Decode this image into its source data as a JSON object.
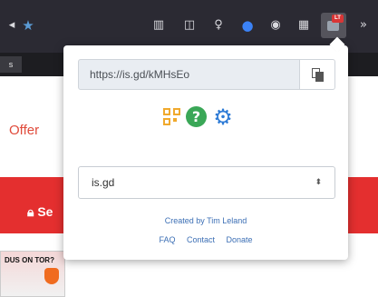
{
  "browser": {
    "toolbar_icons": [
      "library-icon",
      "sidebar-icon",
      "lightbulb-icon",
      "blue-extension-icon",
      "account-icon",
      "grid-icon",
      "active-extension-icon",
      "overflow-icon"
    ],
    "extension_badge": "LT"
  },
  "page": {
    "offer_text": "Offer",
    "red_band_label": "Se",
    "tab_label": "s",
    "ad_text": "DUS ON TOR?"
  },
  "popup": {
    "short_url": "https://is.gd/kMHsEo",
    "icons": [
      "qr-code-icon",
      "help-icon",
      "gear-icon"
    ],
    "help_glyph": "?",
    "service_select": {
      "selected": "is.gd"
    },
    "credit": "Created by Tim Leland",
    "links": [
      "FAQ",
      "Contact",
      "Donate"
    ]
  },
  "colors": {
    "toolbar_bg": "#2b2a33",
    "accent_red": "#e42f2f",
    "link_blue": "#3c6fb5",
    "help_green": "#3aa757",
    "gear_blue": "#2e7bd6",
    "qr_orange": "#f0a92d"
  }
}
